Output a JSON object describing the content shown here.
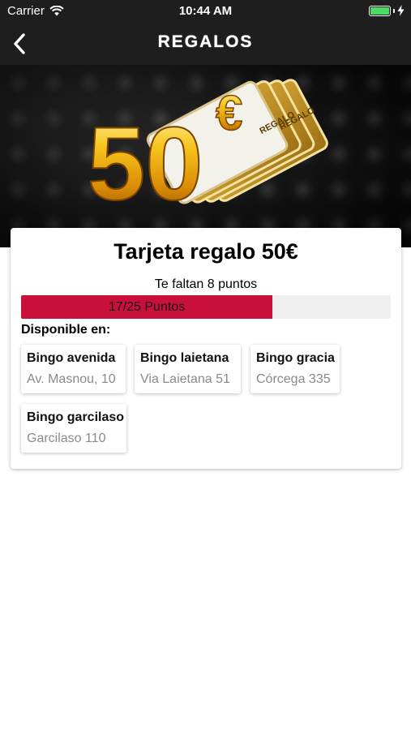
{
  "status_bar": {
    "carrier": "Carrier",
    "time": "10:44 AM"
  },
  "nav": {
    "title": "REGALOS",
    "back_icon": "chevron-left-icon"
  },
  "hero": {
    "amount_text": "50",
    "currency_text": "€",
    "card_text": "REGALO"
  },
  "gift": {
    "title": "Tarjeta regalo 50€",
    "remaining_text": "Te faltan 8 puntos",
    "progress_label": "17/25 Puntos",
    "points_current": 17,
    "points_total": 25,
    "accent_color": "#c8103a",
    "available_label": "Disponible en:"
  },
  "locations": [
    {
      "name": "Bingo avenida",
      "address": "Av. Masnou, 10"
    },
    {
      "name": "Bingo laietana",
      "address": "Via Laietana 51"
    },
    {
      "name": "Bingo gracia",
      "address": "Córcega 335"
    },
    {
      "name": "Bingo garcilaso",
      "address": "Garcilaso 110"
    }
  ]
}
